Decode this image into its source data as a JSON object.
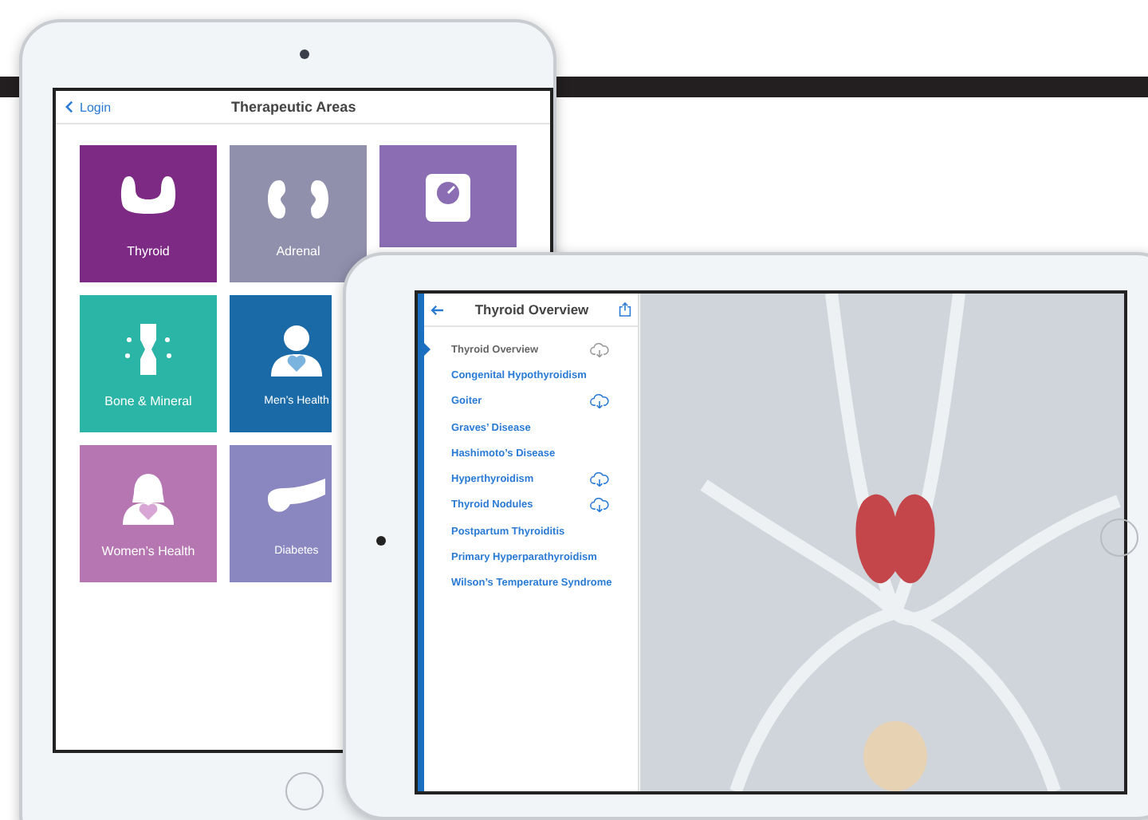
{
  "back_screen": {
    "back_label": "Login",
    "title": "Therapeutic Areas",
    "tile_rows": [
      [
        {
          "label": "Thyroid",
          "kind": "thyroid",
          "color": "#7d2a85"
        },
        {
          "label": "Adrenal",
          "kind": "kidneys",
          "color": "#9090ad"
        },
        {
          "kind": "scale",
          "color": "#8a6db2"
        }
      ],
      [
        {
          "label": "Bone & Mineral",
          "kind": "bone",
          "color": "#2bb5a6"
        },
        {
          "label": "Men’s Health",
          "kind": "man",
          "color": "#196aa6"
        }
      ],
      [
        {
          "label": "Women’s Health",
          "kind": "woman",
          "color": "#b676b1"
        },
        {
          "label": "Diabetes",
          "kind": "pancreas",
          "color": "#8a86c0"
        }
      ]
    ]
  },
  "front_screen": {
    "title": "Thyroid Overview",
    "items": [
      {
        "label": "Thyroid Overview",
        "selected": true,
        "download": true
      },
      {
        "label": "Congenital Hypothyroidism",
        "selected": false,
        "download": false
      },
      {
        "label": "Goiter",
        "selected": false,
        "download": true
      },
      {
        "label": "Graves’ Disease",
        "selected": false,
        "download": false
      },
      {
        "label": "Hashimoto’s Disease",
        "selected": false,
        "download": false
      },
      {
        "label": "Hyperthyroidism",
        "selected": false,
        "download": true
      },
      {
        "label": "Thyroid Nodules",
        "selected": false,
        "download": true
      },
      {
        "label": "Postpartum Thyroiditis",
        "selected": false,
        "download": false
      },
      {
        "label": "Primary Hyperparathyroidism",
        "selected": false,
        "download": false
      },
      {
        "label": "Wilson’s Temperature Syndrome",
        "selected": false,
        "download": false
      }
    ]
  }
}
